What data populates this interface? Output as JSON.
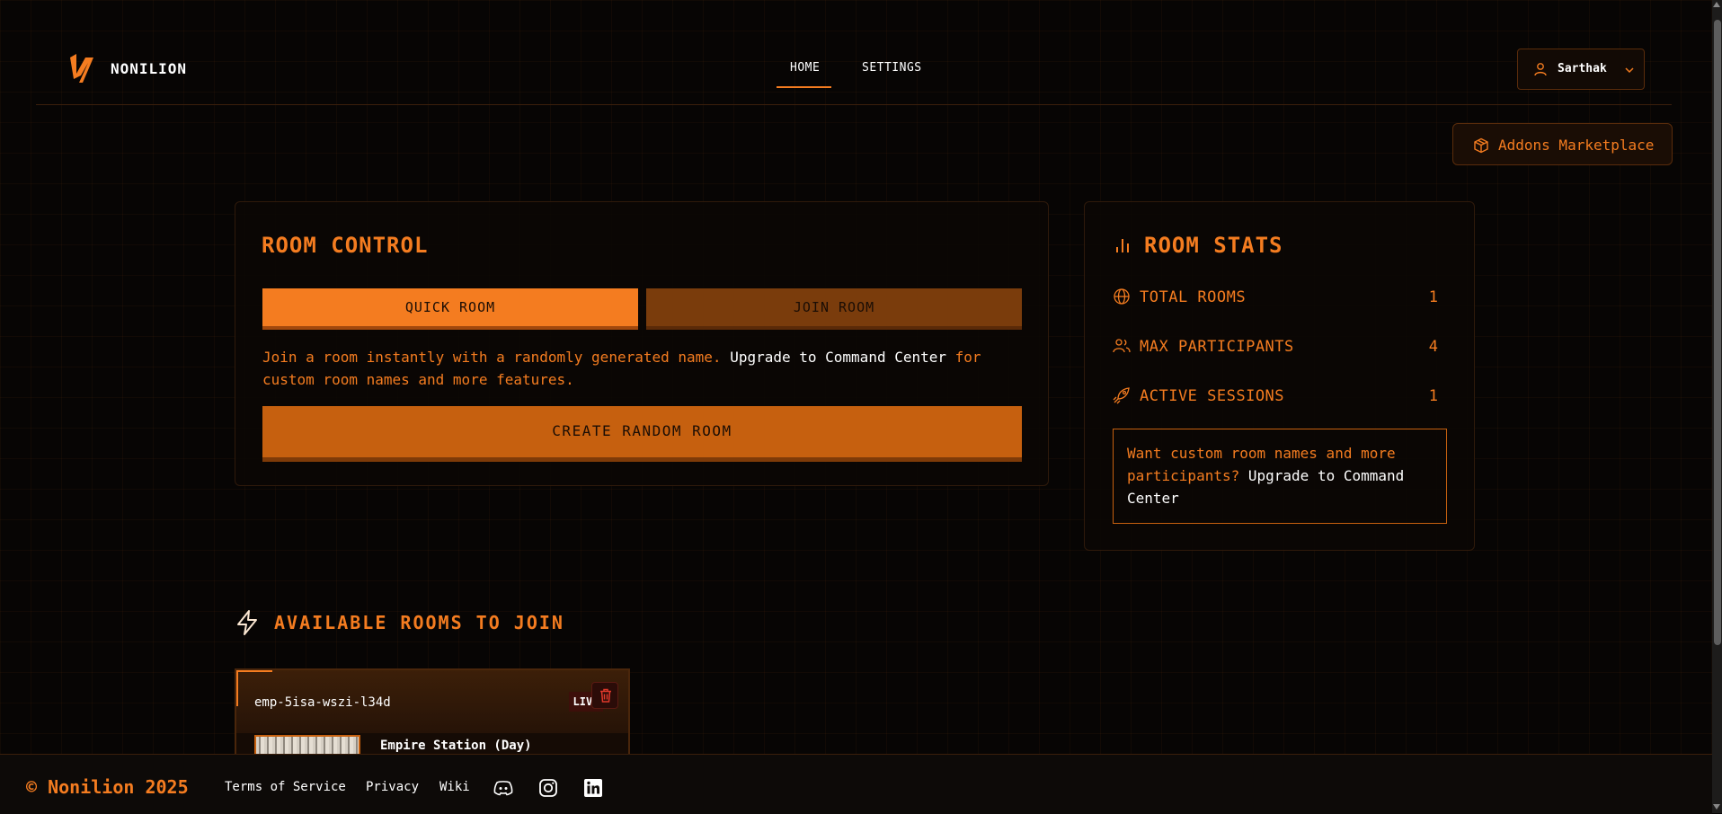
{
  "header": {
    "brand": "NONILION",
    "nav": [
      {
        "label": "HOME",
        "active": true
      },
      {
        "label": "SETTINGS",
        "active": false
      }
    ],
    "user": {
      "name": "Sarthak",
      "icon": "user-icon"
    },
    "addons_label": "Addons Marketplace"
  },
  "room_control": {
    "title": "ROOM CONTROL",
    "quick_room_label": "QUICK ROOM",
    "join_room_label": "JOIN ROOM",
    "desc_prefix": "Join a room instantly with a randomly generated name.",
    "desc_link": "Upgrade to Command Center",
    "desc_suffix": "for custom room names and more features.",
    "create_label": "CREATE RANDOM ROOM"
  },
  "room_stats": {
    "title": "ROOM STATS",
    "items": [
      {
        "label": "TOTAL ROOMS",
        "value": "1",
        "icon": "globe-icon"
      },
      {
        "label": "MAX PARTICIPANTS",
        "value": "4",
        "icon": "users-icon"
      },
      {
        "label": "ACTIVE SESSIONS",
        "value": "1",
        "icon": "rocket-icon"
      }
    ],
    "upgrade_prefix": "Want custom room names and more participants?",
    "upgrade_link": "Upgrade to Command Center"
  },
  "available": {
    "title": "AVAILABLE ROOMS TO JOIN",
    "rooms": [
      {
        "name": "emp-5isa-wszi-l34d",
        "status": "LIVE",
        "map": "Empire Station (Day)"
      }
    ]
  },
  "footer": {
    "copyright": "© Nonilion 2025",
    "links": [
      "Terms of Service",
      "Privacy",
      "Wiki"
    ],
    "socials": [
      "discord-icon",
      "instagram-icon",
      "linkedin-icon"
    ]
  },
  "colors": {
    "accent": "#f47c20",
    "background": "#070504"
  }
}
